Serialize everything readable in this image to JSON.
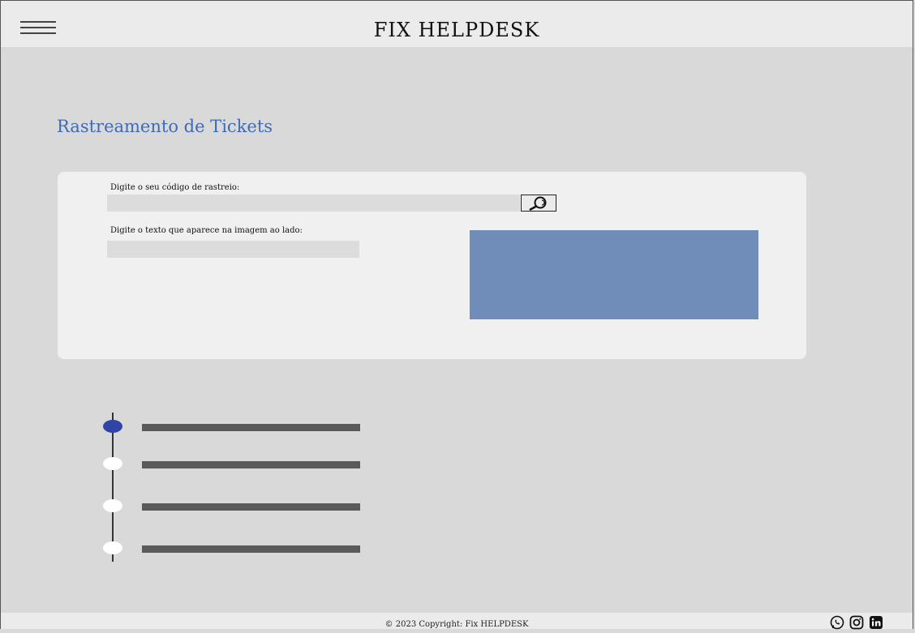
{
  "header": {
    "title": "FIX HELPDESK",
    "menu_icon": "hamburger-menu-icon"
  },
  "main": {
    "page_title": "Rastreamento de Tickets",
    "tracking": {
      "label": "Digite o seu código de rastreio:",
      "value": "",
      "search_icon": "magnifier-icon"
    },
    "captcha": {
      "label": "Digite o texto que aparece na imagem ao lado:",
      "value": "",
      "image_color": "#6f8db8"
    },
    "timeline": {
      "steps": [
        {
          "active": true
        },
        {
          "active": false
        },
        {
          "active": false
        },
        {
          "active": false
        }
      ],
      "active_color": "#2f45a6",
      "inactive_color": "#ffffff"
    }
  },
  "footer": {
    "copyright": "© 2023 Copyright: Fix HELPDESK",
    "social_icons": [
      "whatsapp-icon",
      "instagram-icon",
      "linkedin-icon"
    ]
  },
  "colors": {
    "accent": "#3f6ab6",
    "background": "#d9d9d9",
    "card": "#f0f0f0"
  }
}
